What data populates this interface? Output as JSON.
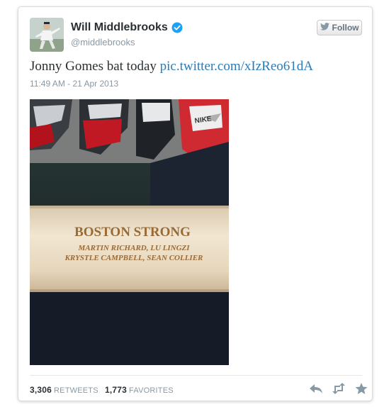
{
  "user": {
    "name": "Will Middlebrooks",
    "handle": "@middlebrooks",
    "verified": true
  },
  "follow_button": {
    "label": "Follow",
    "icon": "bird-icon"
  },
  "tweet": {
    "text": "Jonny Gomes bat today",
    "link": "pic.twitter.com/xIzReo61dA",
    "timestamp": "11:49 AM - 21 Apr 2013"
  },
  "photo": {
    "line1": "BOSTON STRONG",
    "line2": "MARTIN RICHARD, LU LINGZI",
    "line3": "KRYSTLE CAMPBELL, SEAN COLLIER",
    "shoe_brand": "NIKE"
  },
  "stats": {
    "retweets_count": "3,306",
    "retweets_label": "RETWEETS",
    "favorites_count": "1,773",
    "favorites_label": "FAVORITES"
  },
  "actions": [
    "reply-icon",
    "retweet-icon",
    "favorite-icon"
  ],
  "colors": {
    "link": "#2b7bb9",
    "verified": "#1da1f2",
    "meta": "#8899a6",
    "text": "#292f33"
  }
}
